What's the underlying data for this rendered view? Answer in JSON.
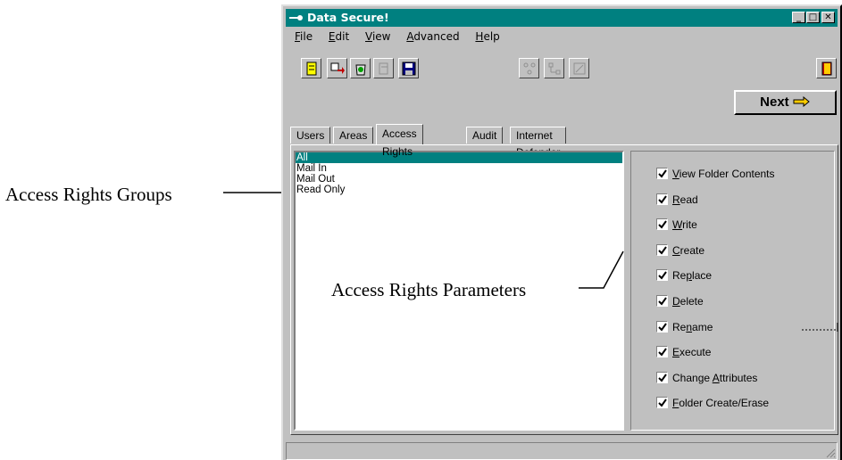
{
  "annotations": {
    "groups_label": "Access Rights Groups",
    "params_label": "Access Rights Parameters"
  },
  "window": {
    "title": "Data Secure!",
    "controls": [
      "minimize-icon",
      "restore-icon",
      "close-icon"
    ]
  },
  "menu": {
    "items": [
      {
        "pre": "",
        "key": "F",
        "post": "ile"
      },
      {
        "pre": "",
        "key": "E",
        "post": "dit"
      },
      {
        "pre": "",
        "key": "V",
        "post": "iew"
      },
      {
        "pre": "",
        "key": "A",
        "post": "dvanced"
      },
      {
        "pre": "",
        "key": "H",
        "post": "elp"
      }
    ]
  },
  "toolbar": {
    "icons": [
      "book-icon",
      "transfer-icon",
      "recycle-icon",
      "disabled-doc-icon",
      "save-disk-icon",
      "network-icon-1",
      "network-icon-2",
      "network-icon-3",
      "exit-door-icon"
    ]
  },
  "next_button": {
    "label": "Next"
  },
  "tabs": [
    {
      "label": "Users"
    },
    {
      "label": "Areas"
    },
    {
      "label": "Access Rights"
    },
    {
      "label": "Audit"
    },
    {
      "label": "Internet Defender"
    }
  ],
  "groups": [
    {
      "label": "All",
      "selected": true
    },
    {
      "label": "Mail In",
      "selected": false
    },
    {
      "label": "Mail Out",
      "selected": false
    },
    {
      "label": "Read Only",
      "selected": false
    }
  ],
  "parameters": [
    {
      "pre": "",
      "key": "V",
      "post": "iew Folder Contents",
      "checked": true
    },
    {
      "pre": "",
      "key": "R",
      "post": "ead",
      "checked": true
    },
    {
      "pre": "",
      "key": "W",
      "post": "rite",
      "checked": true
    },
    {
      "pre": "",
      "key": "C",
      "post": "reate",
      "checked": true
    },
    {
      "pre": "Re",
      "key": "p",
      "post": "lace",
      "checked": true
    },
    {
      "pre": "",
      "key": "D",
      "post": "elete",
      "checked": true
    },
    {
      "pre": "Re",
      "key": "n",
      "post": "ame",
      "checked": true
    },
    {
      "pre": "",
      "key": "E",
      "post": "xecute",
      "checked": true
    },
    {
      "pre": "Change ",
      "key": "A",
      "post": "ttributes",
      "checked": true
    },
    {
      "pre": "",
      "key": "F",
      "post": "older Create/Erase",
      "checked": true
    }
  ],
  "colors": {
    "titlebar": "#008080",
    "selection": "#008080",
    "face": "#c0c0c0"
  }
}
